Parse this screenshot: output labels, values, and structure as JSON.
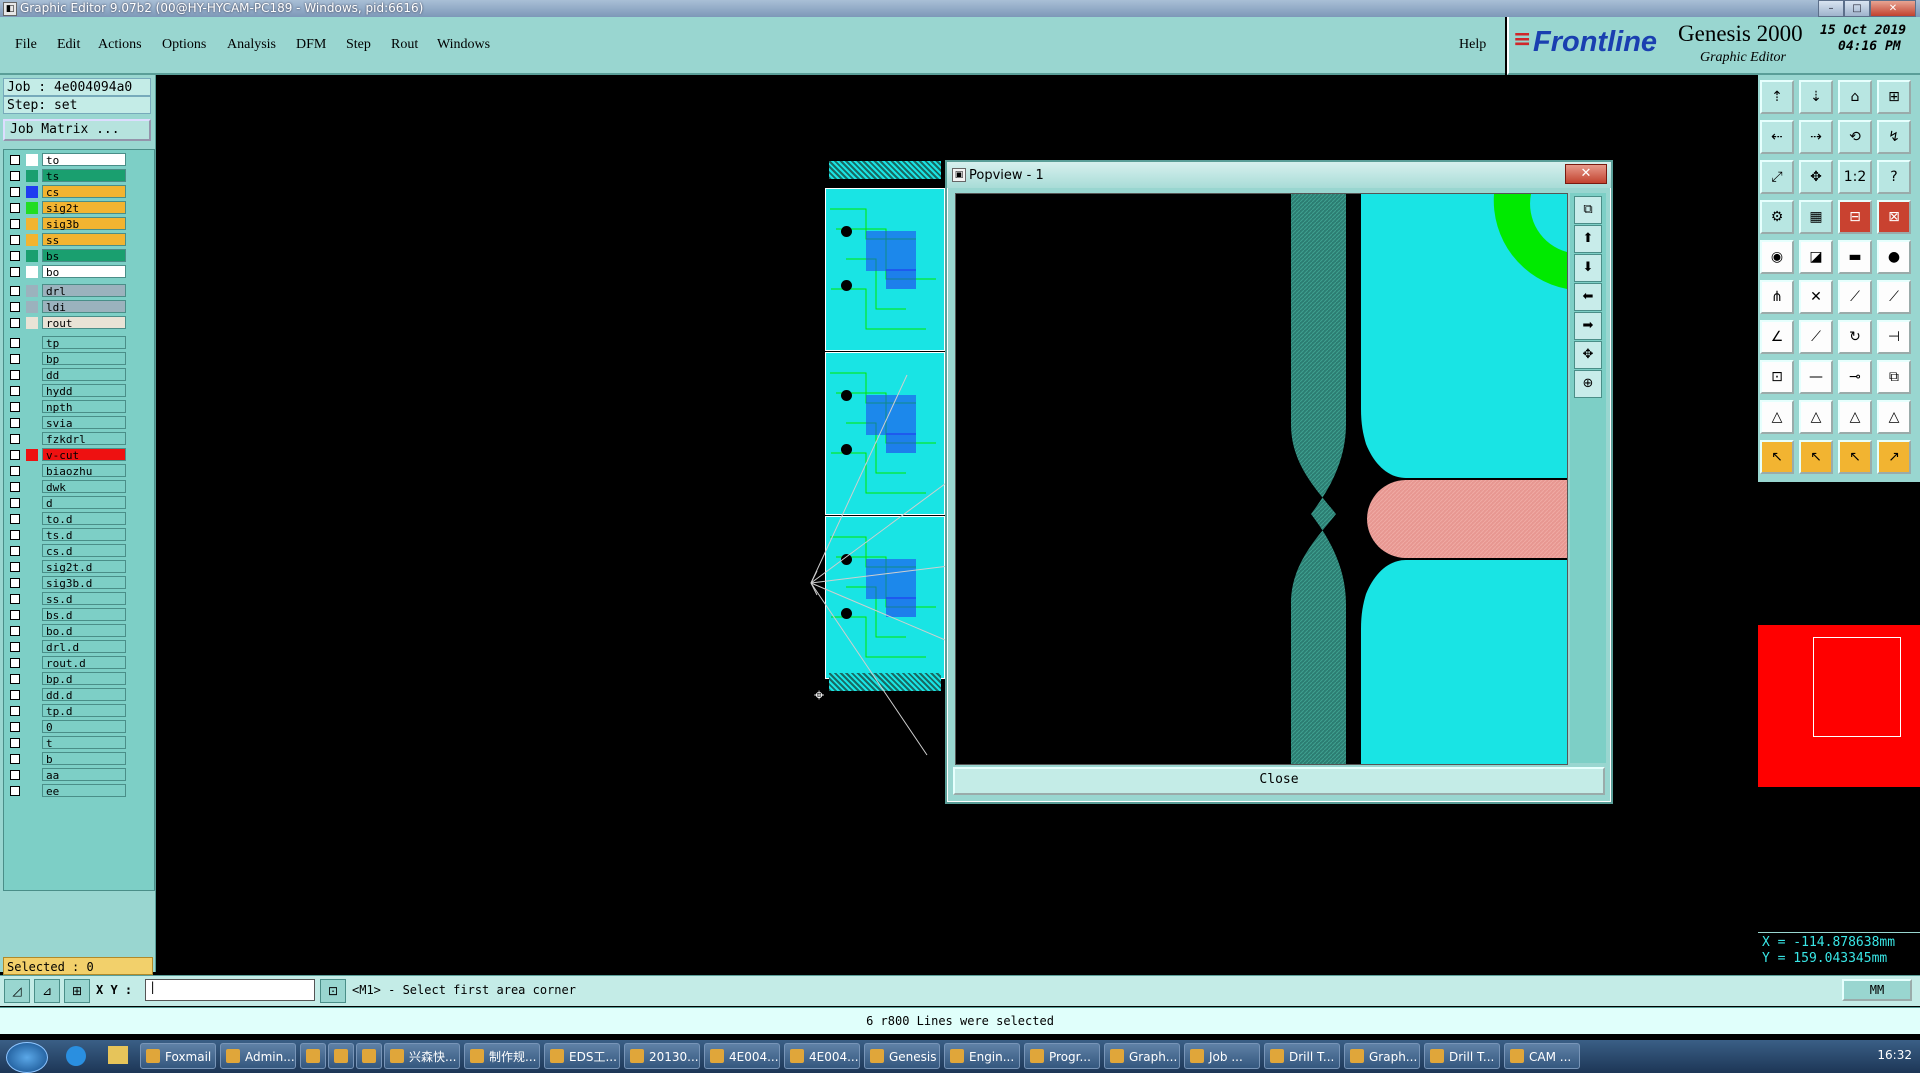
{
  "window": {
    "title": "Graphic Editor 9.07b2 (00@HY-HYCAM-PC189 - Windows, pid:6616)"
  },
  "menu": [
    "File",
    "Edit",
    "Actions",
    "Options",
    "Analysis",
    "DFM",
    "Step",
    "Rout",
    "Windows"
  ],
  "help": "Help",
  "brand": {
    "logo": "Frontline",
    "product": "Genesis 2000",
    "subtitle": "Graphic Editor",
    "date": "15 Oct 2019",
    "time": "04:16 PM"
  },
  "left_panel": {
    "job": "Job : 4e004094a0",
    "step": "Step: set",
    "job_matrix": "Job Matrix ...",
    "layers": [
      {
        "name": "to",
        "color": "#ffffff",
        "bg": "#ffffff"
      },
      {
        "name": "ts",
        "color": "#1a9f6f",
        "bg": "#1a9f6f"
      },
      {
        "name": "cs",
        "color": "#1f3cf0",
        "bg": "#f2b431"
      },
      {
        "name": "sig2t",
        "color": "#22dd22",
        "bg": "#f2b431"
      },
      {
        "name": "sig3b",
        "color": "#f2b431",
        "bg": "#f2b431"
      },
      {
        "name": "ss",
        "color": "#f2b431",
        "bg": "#f2b431"
      },
      {
        "name": "bs",
        "color": "#1a9f6f",
        "bg": "#1a9f6f"
      },
      {
        "name": "bo",
        "color": "#ffffff",
        "bg": "#ffffff"
      },
      {
        "name": "drl",
        "color": "#9bb2bd",
        "bg": "#9bb2bd"
      },
      {
        "name": "ldi",
        "color": "#9bb2bd",
        "bg": "#9bb2bd"
      },
      {
        "name": "rout",
        "color": "#e9e3d6",
        "bg": "#e9e3d6"
      },
      {
        "name": "tp",
        "color": "#7dcfc6",
        "bg": "#7dcfc6"
      },
      {
        "name": "bp",
        "color": "#7dcfc6",
        "bg": "#7dcfc6"
      },
      {
        "name": "dd",
        "color": "#7dcfc6",
        "bg": "#7dcfc6"
      },
      {
        "name": "hydd",
        "color": "#7dcfc6",
        "bg": "#7dcfc6"
      },
      {
        "name": "npth",
        "color": "#7dcfc6",
        "bg": "#7dcfc6"
      },
      {
        "name": "svia",
        "color": "#7dcfc6",
        "bg": "#7dcfc6"
      },
      {
        "name": "fzkdrl",
        "color": "#7dcfc6",
        "bg": "#7dcfc6"
      },
      {
        "name": "v-cut",
        "color": "#ee1111",
        "bg": "#ee1111"
      },
      {
        "name": "biaozhu",
        "color": "#7dcfc6",
        "bg": "#7dcfc6"
      },
      {
        "name": "dwk",
        "color": "#7dcfc6",
        "bg": "#7dcfc6"
      },
      {
        "name": "d",
        "color": "#7dcfc6",
        "bg": "#7dcfc6"
      },
      {
        "name": "to.d",
        "color": "#7dcfc6",
        "bg": "#7dcfc6"
      },
      {
        "name": "ts.d",
        "color": "#7dcfc6",
        "bg": "#7dcfc6"
      },
      {
        "name": "cs.d",
        "color": "#7dcfc6",
        "bg": "#7dcfc6"
      },
      {
        "name": "sig2t.d",
        "color": "#7dcfc6",
        "bg": "#7dcfc6"
      },
      {
        "name": "sig3b.d",
        "color": "#7dcfc6",
        "bg": "#7dcfc6"
      },
      {
        "name": "ss.d",
        "color": "#7dcfc6",
        "bg": "#7dcfc6"
      },
      {
        "name": "bs.d",
        "color": "#7dcfc6",
        "bg": "#7dcfc6"
      },
      {
        "name": "bo.d",
        "color": "#7dcfc6",
        "bg": "#7dcfc6"
      },
      {
        "name": "drl.d",
        "color": "#7dcfc6",
        "bg": "#7dcfc6"
      },
      {
        "name": "rout.d",
        "color": "#7dcfc6",
        "bg": "#7dcfc6"
      },
      {
        "name": "bp.d",
        "color": "#7dcfc6",
        "bg": "#7dcfc6"
      },
      {
        "name": "dd.d",
        "color": "#7dcfc6",
        "bg": "#7dcfc6"
      },
      {
        "name": "tp.d",
        "color": "#7dcfc6",
        "bg": "#7dcfc6"
      },
      {
        "name": "0",
        "color": "#7dcfc6",
        "bg": "#7dcfc6"
      },
      {
        "name": "t",
        "color": "#7dcfc6",
        "bg": "#7dcfc6"
      },
      {
        "name": "b",
        "color": "#7dcfc6",
        "bg": "#7dcfc6"
      },
      {
        "name": "aa",
        "color": "#7dcfc6",
        "bg": "#7dcfc6"
      },
      {
        "name": "ee",
        "color": "#7dcfc6",
        "bg": "#7dcfc6"
      }
    ],
    "selected": "Selected : 0"
  },
  "popview": {
    "title": "Popview - 1",
    "close_label": "Close",
    "close_x": "✕"
  },
  "coords": {
    "x": "X = -114.878638mm",
    "y": "Y =  159.043345mm"
  },
  "command": {
    "xy_label": "X Y :",
    "prompt": "<M1> - Select first area corner",
    "unit": "MM"
  },
  "status": "6 r800 Lines were selected",
  "taskbar": {
    "items": [
      "Foxmail",
      "Admin...",
      "",
      "",
      "",
      "兴森快...",
      "制作规...",
      "EDS工...",
      "20130...",
      "4E004...",
      "4E004...",
      "Genesis",
      "Engin...",
      "Progr...",
      "Graph...",
      "Job ...",
      "Drill T...",
      "Graph...",
      "Drill T...",
      "CAM ..."
    ],
    "clock": "16:32"
  },
  "colors": {
    "panel": "#99d6d0",
    "board_cyan": "#19e4e4",
    "dark_teal": "#2c7d72",
    "pad_pink": "#e79791",
    "green_trace": "#00ea00"
  }
}
